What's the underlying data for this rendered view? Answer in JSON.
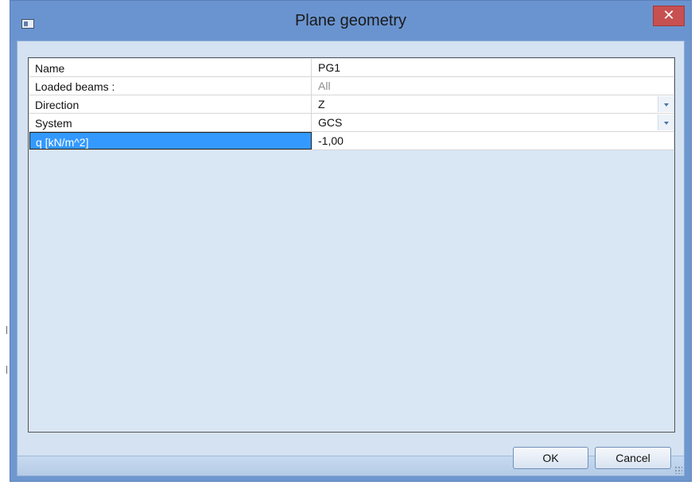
{
  "window": {
    "title": "Plane geometry",
    "close_glyph": "✕"
  },
  "properties": [
    {
      "label": "Name",
      "value": "PG1",
      "dropdown": false,
      "muted": false,
      "selected": false
    },
    {
      "label": "Loaded beams :",
      "value": "All",
      "dropdown": false,
      "muted": true,
      "selected": false
    },
    {
      "label": "Direction",
      "value": "Z",
      "dropdown": true,
      "muted": false,
      "selected": false
    },
    {
      "label": "System",
      "value": "GCS",
      "dropdown": true,
      "muted": false,
      "selected": false
    },
    {
      "label": "q [kN/m^2]",
      "value": "-1,00",
      "dropdown": false,
      "muted": false,
      "selected": true
    }
  ],
  "buttons": {
    "ok_label": "OK",
    "cancel_label": "Cancel"
  },
  "icons": {
    "app": "window-app-icon",
    "close": "close-icon",
    "dropdown": "chevron-down-icon",
    "resize": "resize-grip-icon"
  }
}
